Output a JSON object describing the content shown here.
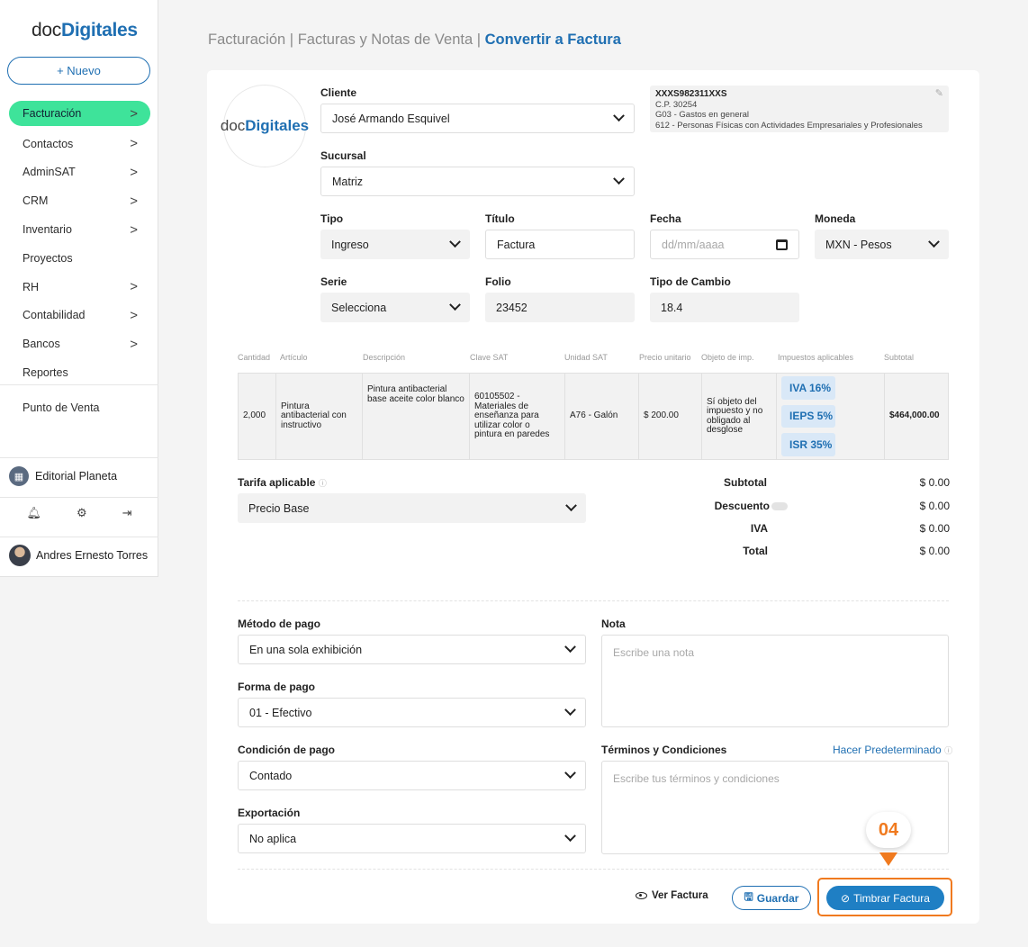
{
  "sidebar": {
    "logo_prefix": "doc",
    "logo_brand": "Digitales",
    "new_button": "+ Nuevo",
    "items": [
      {
        "label": "Facturación",
        "chev": ">"
      },
      {
        "label": "Contactos",
        "chev": ">"
      },
      {
        "label": "AdminSAT",
        "chev": ">"
      },
      {
        "label": "CRM",
        "chev": ">"
      },
      {
        "label": "Inventario",
        "chev": ">"
      },
      {
        "label": "Proyectos",
        "chev": ""
      },
      {
        "label": "RH",
        "chev": ">"
      },
      {
        "label": "Contabilidad",
        "chev": ">"
      },
      {
        "label": "Bancos",
        "chev": ">"
      },
      {
        "label": "Reportes",
        "chev": ""
      },
      {
        "label": "Punto de Venta",
        "chev": ""
      }
    ],
    "company": "Editorial Planeta",
    "user": "Andres Ernesto Torres"
  },
  "breadcrumb": {
    "part1": "Facturación",
    "part2": "Facturas y Notas de Venta",
    "current": "Convertir a Factura"
  },
  "client": {
    "logo_prefix": "doc",
    "logo_brand": "Digitales",
    "cliente_label": "Cliente",
    "cliente_value": "José Armando Esquivel",
    "sucursal_label": "Sucursal",
    "sucursal_value": "Matriz",
    "rfc": "XXXS982311XXS",
    "cp": "C.P. 30254",
    "uso": "G03 - Gastos en general",
    "regimen": "612 - Personas Físicas con Actividades Empresariales y Profesionales"
  },
  "form": {
    "tipo_label": "Tipo",
    "tipo_value": "Ingreso",
    "titulo_label": "Título",
    "titulo_value": "Factura",
    "fecha_label": "Fecha",
    "fecha_placeholder": "dd/mm/aaaa",
    "moneda_label": "Moneda",
    "moneda_value": "MXN - Pesos",
    "serie_label": "Serie",
    "serie_value": "Selecciona",
    "folio_label": "Folio",
    "folio_value": "23452",
    "cambio_label": "Tipo de Cambio",
    "cambio_value": "18.4"
  },
  "table": {
    "headers": [
      "Cantidad",
      "Artículo",
      "Descripción",
      "Clave SAT",
      "Unidad SAT",
      "Precio unitario",
      "Objeto de imp.",
      "Impuestos aplicables",
      "Subtotal"
    ],
    "row": {
      "cantidad": "2,000",
      "articulo": "Pintura antibacterial con instructivo",
      "descripcion": "Pintura antibacterial base aceite color blanco",
      "clave": "60105502 - Materiales de enseñanza para utilizar color o pintura en paredes",
      "unidad": "A76 - Galón",
      "precio": "$ 200.00",
      "objeto": "Sí objeto del impuesto y no obligado al desglose",
      "impuestos": [
        "IVA 16%",
        "IEPS 5%",
        "ISR 35%"
      ],
      "subtotal": "$464,000.00"
    }
  },
  "tarifa": {
    "label": "Tarifa aplicable",
    "info": "ⓘ",
    "value": "Precio Base"
  },
  "totals": {
    "subtotal_label": "Subtotal",
    "subtotal_value": "$ 0.00",
    "descuento_label": "Descuento",
    "descuento_value": "$ 0.00",
    "iva_label": "IVA",
    "iva_value": "$ 0.00",
    "total_label": "Total",
    "total_value": "$ 0.00"
  },
  "payment": {
    "metodo_label": "Método de pago",
    "metodo_value": "En una sola exhibición",
    "forma_label": "Forma de pago",
    "forma_value": "01 - Efectivo",
    "condicion_label": "Condición de pago",
    "condicion_value": "Contado",
    "exportacion_label": "Exportación",
    "exportacion_value": "No aplica",
    "nota_label": "Nota",
    "nota_placeholder": "Escribe una nota",
    "terminos_label": "Términos y Condiciones",
    "terminos_placeholder": "Escribe tus términos y condiciones",
    "predeterminado_link": "Hacer Predeterminado"
  },
  "actions": {
    "ver": "Ver Factura",
    "guardar": "Guardar",
    "timbrar": "Timbrar Factura",
    "step_badge": "04"
  },
  "colors": {
    "accent": "#1f6fb2",
    "active_nav": "#3ee39a",
    "highlight": "#f07a1f"
  }
}
